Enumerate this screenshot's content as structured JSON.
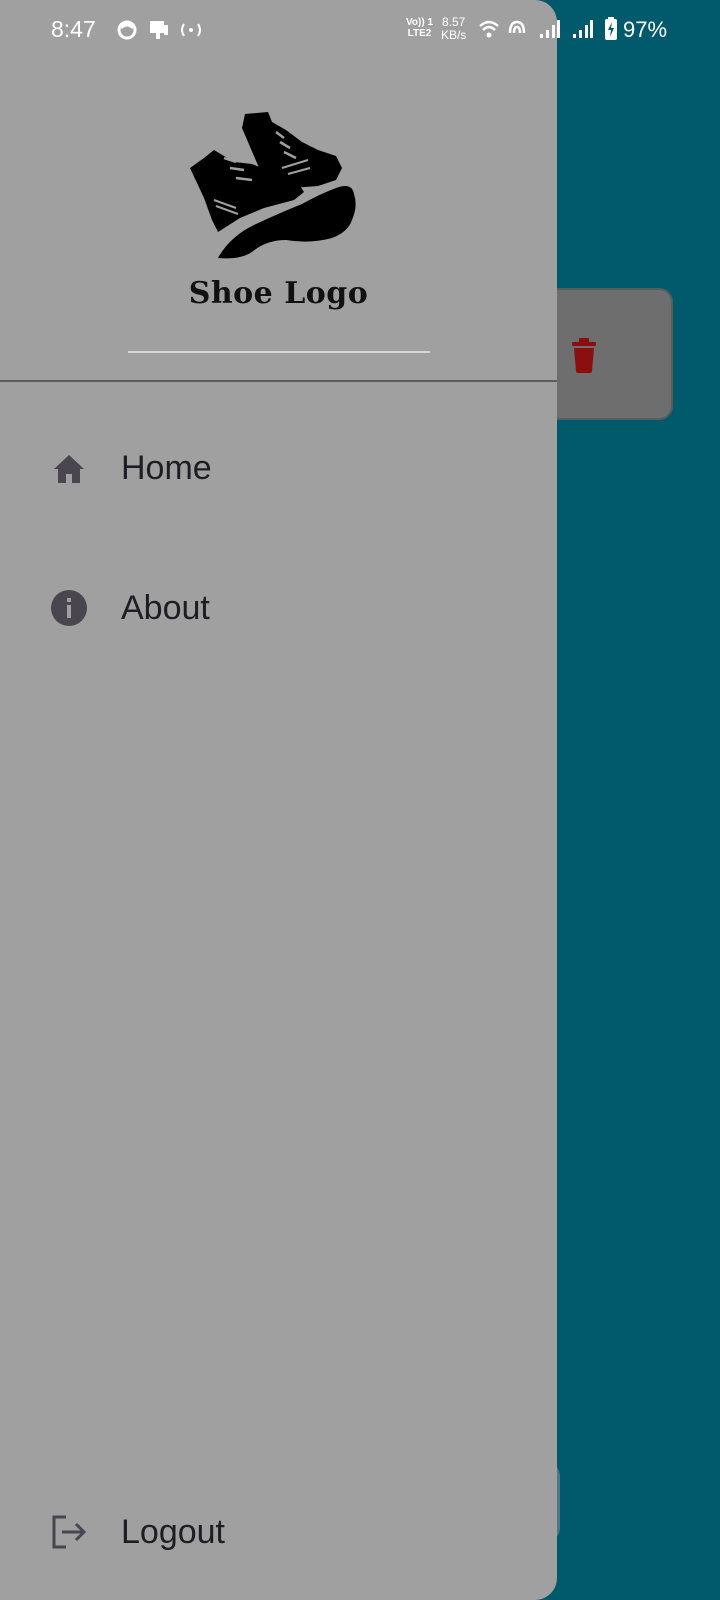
{
  "status_bar": {
    "time": "8:47",
    "volte_line1": "Vo)) 1",
    "volte_line2": "LTE2",
    "net_speed_value": "8.57",
    "net_speed_unit": "KB/s",
    "battery_percent": "97%",
    "icons": [
      "circle-status-icon",
      "sim-card-icon",
      "hotspot-icon",
      "wifi-icon",
      "nfc-icon",
      "signal-1-icon",
      "signal-2-icon",
      "battery-charging-icon"
    ]
  },
  "drawer": {
    "logo_text": "Shoe Logo",
    "items": [
      {
        "label": "Home",
        "icon": "home-icon"
      },
      {
        "label": "About",
        "icon": "info-icon"
      }
    ],
    "footer": {
      "label": "Logout",
      "icon": "logout-icon"
    }
  },
  "background": {
    "delete_icon": "trash-icon"
  },
  "colors": {
    "app_background": "#005a6c",
    "drawer_background": "#a0a0a0",
    "card_background": "#6e6e6e",
    "delete_icon": "#8b0f0f",
    "nav_icon": "#4a4650",
    "nav_text": "#1f1d24"
  }
}
